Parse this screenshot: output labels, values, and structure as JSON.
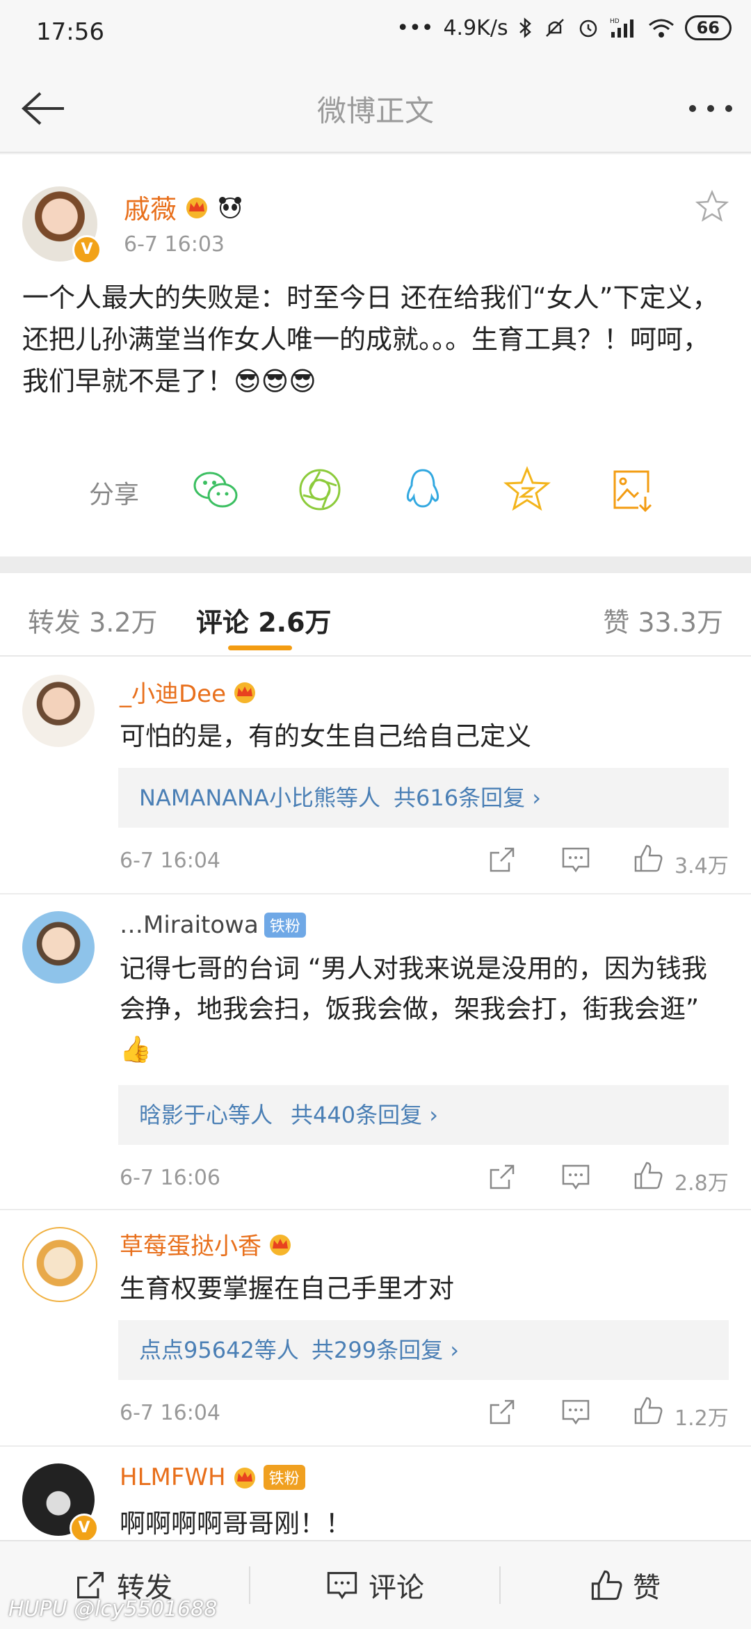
{
  "status": {
    "time": "17:56",
    "network": "4.9K/s",
    "battery": "66",
    "hd": "HD"
  },
  "nav": {
    "title": "微博正文"
  },
  "post": {
    "author": "戚薇",
    "time": "6-7 16:03",
    "v_badge": "V",
    "content": "一个人最大的失败是：时至今日 还在给我们“女人”下定义，还把儿孙满堂当作女人唯一的成就。。。生育工具？！呵呵，我们早就不是了！😎😎😎",
    "share_label": "分享"
  },
  "tabs": [
    {
      "label": "转发 3.2万"
    },
    {
      "label": "评论 2.6万"
    },
    {
      "label": "赞 33.3万"
    }
  ],
  "comments": [
    {
      "name": "_小迪Dee",
      "text": "可怕的是，有的女生自己给自己定义",
      "reply_who": "NAMANANA小比熊等人",
      "reply_count": "共616条回复 ›",
      "time": "6-7 16:04",
      "likes": "3.4万"
    },
    {
      "name": "…Miraitowa",
      "badge": "铁粉",
      "text": "记得七哥的台词 “男人对我来说是没用的，因为钱我会挣，地我会扫，饭我会做，架我会打，街我会逛” 👍",
      "reply_who": "晗影于心等人",
      "reply_count": "共440条回复 ›",
      "time": "6-7 16:06",
      "likes": "2.8万"
    },
    {
      "name": "草莓蛋挞小香",
      "text": "生育权要掌握在自己手里才对",
      "reply_who": "点点95642等人",
      "reply_count": "共299条回复 ›",
      "time": "6-7 16:04",
      "likes": "1.2万"
    },
    {
      "name": "HLMFWH",
      "badge": "铁粉",
      "text": "啊啊啊啊哥哥刚！！"
    }
  ],
  "bottom": {
    "repost": "转发",
    "comment": "评论",
    "like": "赞"
  },
  "watermark": "HUPU @lcy5501688",
  "colors": {
    "accent": "#f39c12",
    "name": "#e86f1b",
    "link": "#4a7fb5"
  }
}
